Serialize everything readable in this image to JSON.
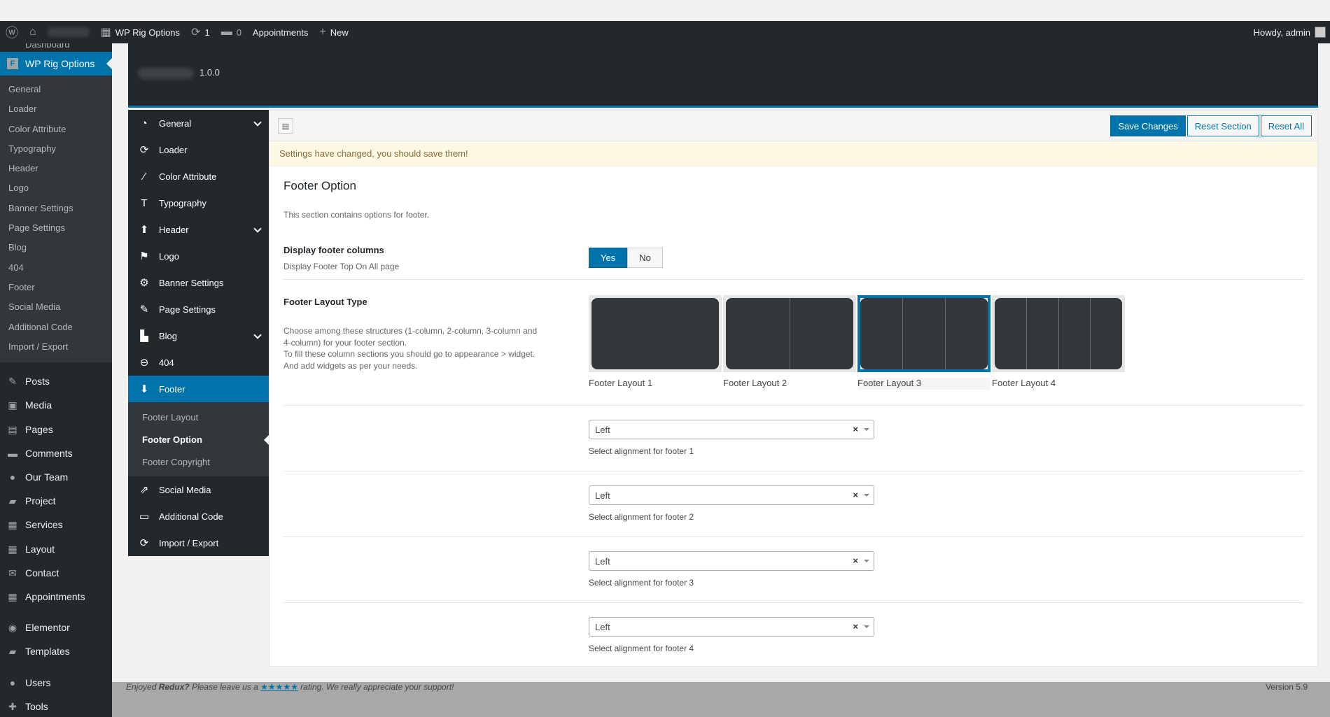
{
  "adminbar": {
    "site_title": "WP Rig Options",
    "updates_count": "1",
    "comments_count": "0",
    "appointments": "Appointments",
    "new": "New",
    "howdy": "Howdy, admin"
  },
  "wp_sidebar": {
    "top_cut": "Dashboard",
    "active": "WP Rig Options",
    "active_badge": "F",
    "submenu": [
      "General",
      "Loader",
      "Color Attribute",
      "Typography",
      "Header",
      "Logo",
      "Banner Settings",
      "Page Settings",
      "Blog",
      "404",
      "Footer",
      "Social Media",
      "Additional Code",
      "Import / Export"
    ],
    "menu": [
      {
        "label": "Posts",
        "icon": "pin-icon",
        "glyph": "✎"
      },
      {
        "label": "Media",
        "icon": "media-icon",
        "glyph": "▣"
      },
      {
        "label": "Pages",
        "icon": "pages-icon",
        "glyph": "▤"
      },
      {
        "label": "Comments",
        "icon": "comments-icon",
        "glyph": "▬"
      },
      {
        "label": "Our Team",
        "icon": "team-icon",
        "glyph": "●"
      },
      {
        "label": "Project",
        "icon": "folder-icon",
        "glyph": "▰"
      },
      {
        "label": "Services",
        "icon": "services-icon",
        "glyph": "▦"
      },
      {
        "label": "Layout",
        "icon": "grid-icon",
        "glyph": "▦"
      },
      {
        "label": "Contact",
        "icon": "mail-icon",
        "glyph": "✉"
      },
      {
        "label": "Appointments",
        "icon": "calendar-icon",
        "glyph": "▦"
      }
    ],
    "menu2": [
      {
        "label": "Elementor",
        "icon": "elementor-icon",
        "glyph": "◉"
      },
      {
        "label": "Templates",
        "icon": "templates-icon",
        "glyph": "▰"
      }
    ],
    "menu3": [
      {
        "label": "Users",
        "icon": "users-icon",
        "glyph": "●"
      },
      {
        "label": "Tools",
        "icon": "tools-icon",
        "glyph": "✚"
      }
    ]
  },
  "redux": {
    "version": "1.0.0",
    "nav": [
      {
        "label": "General",
        "icon": "dashboard-icon",
        "glyph": "◔",
        "has_children": true
      },
      {
        "label": "Loader",
        "icon": "refresh-icon",
        "glyph": "⟳",
        "has_children": false
      },
      {
        "label": "Color Attribute",
        "icon": "brush-icon",
        "glyph": "⁄",
        "has_children": false
      },
      {
        "label": "Typography",
        "icon": "text-icon",
        "glyph": "T",
        "has_children": false
      },
      {
        "label": "Header",
        "icon": "arrow-up-icon",
        "glyph": "⬆",
        "has_children": true
      },
      {
        "label": "Logo",
        "icon": "flag-icon",
        "glyph": "⚑",
        "has_children": false
      },
      {
        "label": "Banner Settings",
        "icon": "gear-icon",
        "glyph": "⚙",
        "has_children": false
      },
      {
        "label": "Page Settings",
        "icon": "edit-icon",
        "glyph": "✎",
        "has_children": false
      },
      {
        "label": "Blog",
        "icon": "blog-icon",
        "glyph": "▙",
        "has_children": true
      },
      {
        "label": "404",
        "icon": "minus-circle-icon",
        "glyph": "⊖",
        "has_children": false
      },
      {
        "label": "Footer",
        "icon": "arrow-down-icon",
        "glyph": "⬇",
        "has_children": false,
        "active": true
      }
    ],
    "footer_sub": [
      "Footer Layout",
      "Footer Option",
      "Footer Copyright"
    ],
    "nav_after": [
      {
        "label": "Social Media",
        "icon": "share-icon",
        "glyph": "⇗"
      },
      {
        "label": "Additional Code",
        "icon": "code-icon",
        "glyph": "▭"
      },
      {
        "label": "Import / Export",
        "icon": "refresh-icon",
        "glyph": "⟳"
      }
    ],
    "buttons": {
      "save": "Save Changes",
      "reset_section": "Reset Section",
      "reset_all": "Reset All"
    },
    "notice": "Settings have changed, you should save them!",
    "section_title": "Footer Option",
    "section_desc": "This section contains options for footer.",
    "display_columns": {
      "label": "Display footer columns",
      "sub": "Display Footer Top On All page",
      "yes": "Yes",
      "no": "No",
      "value": "Yes"
    },
    "layout_type": {
      "label": "Footer Layout Type",
      "desc_lines": [
        "Choose among these structures (1-column, 2-column, 3-column and",
        "4-column) for your footer section.",
        "To fill these column sections you should go to appearance > widget.",
        "And add widgets as per your needs."
      ],
      "options": [
        {
          "caption": "Footer Layout 1",
          "columns": 1
        },
        {
          "caption": "Footer Layout 2",
          "columns": 2
        },
        {
          "caption": "Footer Layout 3",
          "columns": 3
        },
        {
          "caption": "Footer Layout 4",
          "columns": 4
        }
      ],
      "selected": "Footer Layout 3"
    },
    "alignments": [
      {
        "value": "Left",
        "desc": "Select alignment for footer 1"
      },
      {
        "value": "Left",
        "desc": "Select alignment for footer 2"
      },
      {
        "value": "Left",
        "desc": "Select alignment for footer 3"
      },
      {
        "value": "Left",
        "desc": "Select alignment for footer 4"
      }
    ]
  },
  "footer": {
    "thanks_pre": "Enjoyed",
    "thanks_brand": "Redux?",
    "thanks_mid": "Please leave us a",
    "thanks_stars": "★★★★★",
    "thanks_post": "rating. We really appreciate your support!",
    "version": "Version 5.9"
  }
}
